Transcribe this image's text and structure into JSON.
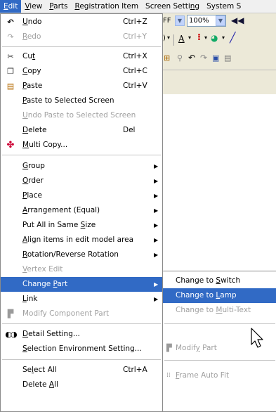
{
  "menubar": [
    {
      "label": "Edit",
      "u": "E",
      "rest": "dit",
      "active": true
    },
    {
      "label": "View",
      "u": "V",
      "rest": "iew"
    },
    {
      "label": "Parts",
      "u": "P",
      "rest": "arts"
    },
    {
      "label": "Registration Item",
      "u": "R",
      "rest": "egistration Item"
    },
    {
      "label": "Screen Setting",
      "pre": "Screen Setti",
      "u": "n",
      "rest": "g"
    },
    {
      "label": "System S",
      "pre": "System S",
      "u": "",
      "rest": ""
    }
  ],
  "toolbar": {
    "combo1_value": "FF",
    "combo2_value": "100%",
    "font_label": "A"
  },
  "menu": {
    "undo": {
      "pre": "",
      "u": "U",
      "rest": "ndo",
      "shortcut": "Ctrl+Z"
    },
    "redo": {
      "pre": "",
      "u": "R",
      "rest": "edo",
      "shortcut": "Ctrl+Y"
    },
    "cut": {
      "pre": "Cu",
      "u": "t",
      "rest": "",
      "shortcut": "Ctrl+X"
    },
    "copy": {
      "pre": "",
      "u": "C",
      "rest": "opy",
      "shortcut": "Ctrl+C"
    },
    "paste": {
      "pre": "",
      "u": "P",
      "rest": "aste",
      "shortcut": "Ctrl+V"
    },
    "paste_selected": {
      "pre": "",
      "u": "P",
      "rest": "aste to Selected Screen"
    },
    "undo_paste": {
      "pre": "",
      "u": "U",
      "rest": "ndo Paste to Selected Screen"
    },
    "delete": {
      "pre": "",
      "u": "D",
      "rest": "elete",
      "shortcut": "Del"
    },
    "multi_copy": {
      "pre": "",
      "u": "M",
      "rest": "ulti Copy..."
    },
    "group": {
      "pre": "",
      "u": "G",
      "rest": "roup"
    },
    "order": {
      "pre": "",
      "u": "O",
      "rest": "rder"
    },
    "place": {
      "pre": "",
      "u": "P",
      "rest": "lace"
    },
    "arrangement": {
      "pre": "",
      "u": "A",
      "rest": "rrangement (Equal)"
    },
    "same_size": {
      "pre": "Put All in Same ",
      "u": "S",
      "rest": "ize"
    },
    "align": {
      "pre": "",
      "u": "A",
      "rest": "lign items in edit model area"
    },
    "rotation": {
      "pre": "",
      "u": "R",
      "rest": "otation/Reverse Rotation"
    },
    "vertex": {
      "pre": "",
      "u": "V",
      "rest": "ertex Edit"
    },
    "change_part": {
      "pre": "Change ",
      "u": "P",
      "rest": "art"
    },
    "link": {
      "pre": "",
      "u": "L",
      "rest": "ink"
    },
    "modify_component": {
      "pre": "Modify Component Part",
      "u": "",
      "rest": ""
    },
    "detail_setting": {
      "pre": "",
      "u": "D",
      "rest": "etail Setting..."
    },
    "selection_env": {
      "pre": "",
      "u": "S",
      "rest": "election Environment Setting..."
    },
    "select_all": {
      "pre": "Se",
      "u": "l",
      "rest": "ect All",
      "shortcut": "Ctrl+A"
    },
    "delete_all": {
      "pre": "Delete ",
      "u": "A",
      "rest": "ll"
    }
  },
  "submenu": {
    "change_switch": {
      "pre": "Change to ",
      "u": "S",
      "rest": "witch"
    },
    "change_lamp": {
      "pre": "Change to ",
      "u": "L",
      "rest": "amp"
    },
    "change_multitext": {
      "pre": "Change to ",
      "u": "M",
      "rest": "ulti-Text"
    },
    "modify_part": {
      "pre": "Modif",
      "u": "y",
      "rest": " Part"
    },
    "frame_auto_fit": {
      "pre": "",
      "u": "F",
      "rest": "rame Auto Fit"
    }
  }
}
